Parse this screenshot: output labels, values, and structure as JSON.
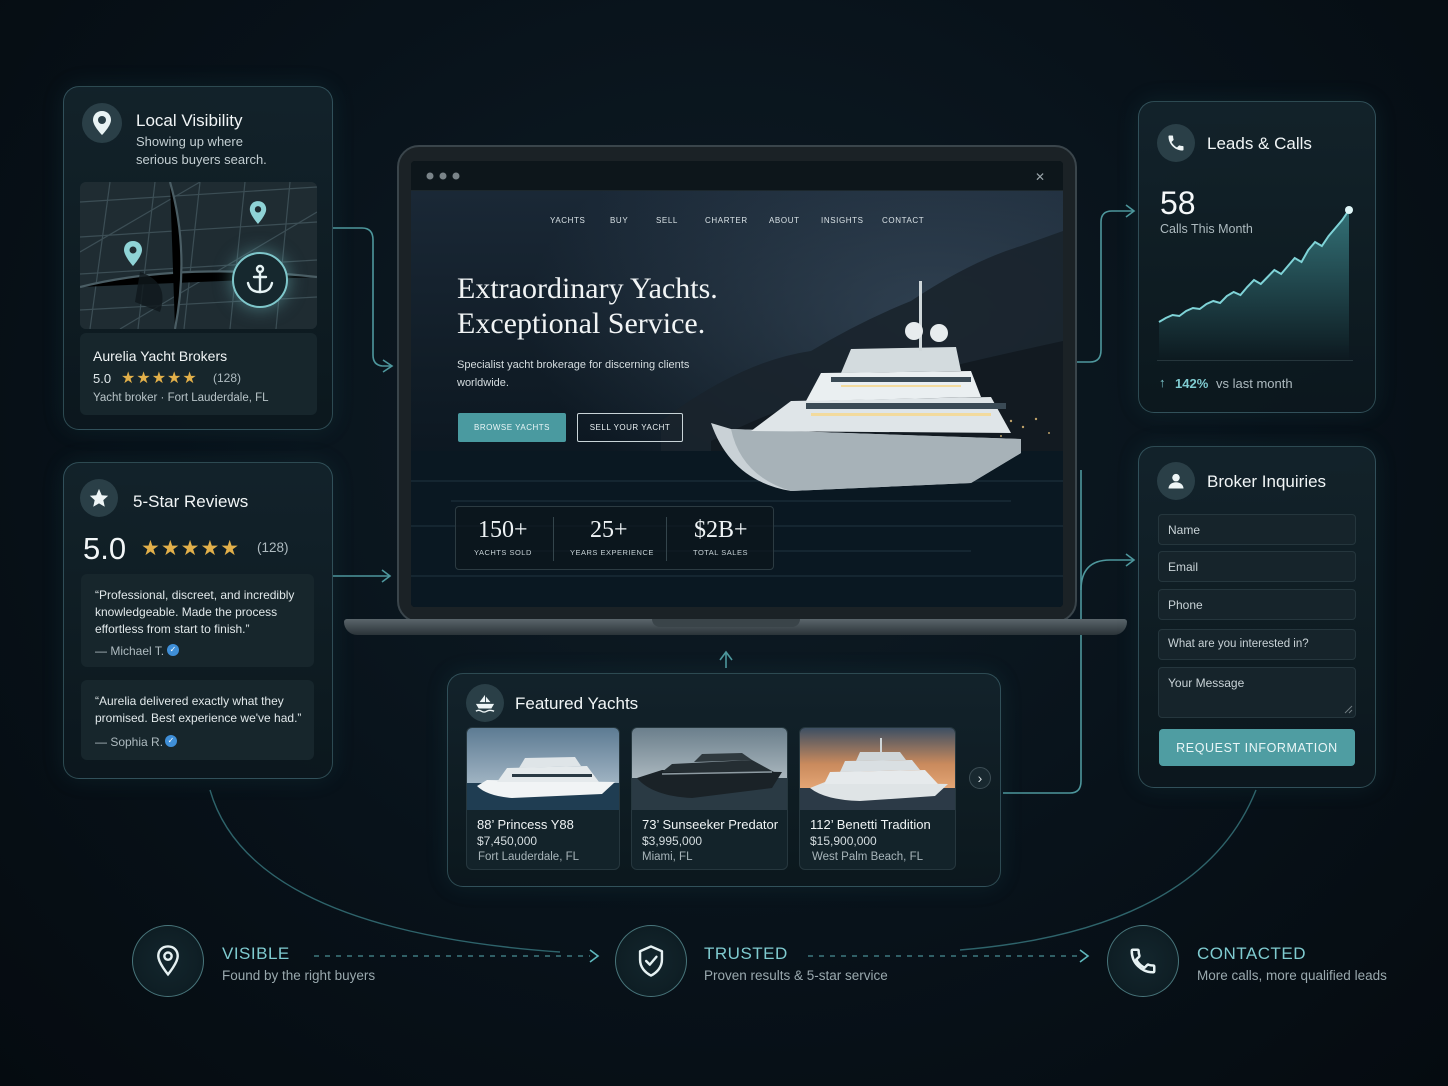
{
  "local_visibility": {
    "title": "Local Visibility",
    "subtitle_line1": "Showing up where",
    "subtitle_line2": "serious buyers search.",
    "business_name": "Aurelia Yacht Brokers",
    "rating": "5.0",
    "review_count": "(128)",
    "category": "Yacht broker · Fort Lauderdale, FL",
    "icon": "map-pin-icon",
    "map_icon": "anchor-icon"
  },
  "reviews": {
    "title": "5-Star Reviews",
    "rating": "5.0",
    "review_count": "(128)",
    "stars": 5,
    "items": [
      {
        "line1": "“Professional, discreet, and incredibly",
        "line2": "knowledgeable. Made the process",
        "line3": "effortless from start to finish.”",
        "author": "— Michael T."
      },
      {
        "line1": "“Aurelia delivered exactly what they",
        "line2": "promised. Best experience we've had.”",
        "author": "— Sophia R."
      }
    ]
  },
  "website": {
    "nav": [
      "YACHTS",
      "BUY",
      "SELL",
      "CHARTER",
      "ABOUT",
      "INSIGHTS",
      "CONTACT"
    ],
    "headline_line1": "Extraordinary Yachts.",
    "headline_line2": "Exceptional Service.",
    "sub_line1": "Specialist yacht brokerage for discerning clients",
    "sub_line2": "worldwide.",
    "primary_cta": "BROWSE YACHTS",
    "secondary_cta": "SELL YOUR YACHT",
    "stats": [
      {
        "value": "150+",
        "label": "YACHTS SOLD"
      },
      {
        "value": "25+",
        "label": "YEARS EXPERIENCE"
      },
      {
        "value": "$2B+",
        "label": "TOTAL SALES"
      }
    ]
  },
  "leads": {
    "title": "Leads & Calls",
    "count": "58",
    "count_label": "Calls This Month",
    "growth": "142%",
    "growth_label": "vs last month",
    "icon": "phone-icon"
  },
  "chart_data": {
    "type": "area",
    "title": "",
    "xlabel": "",
    "ylabel": "",
    "values": [
      10,
      14,
      17,
      16,
      21,
      24,
      23,
      28,
      31,
      29,
      36,
      40,
      37,
      45,
      52,
      48,
      55,
      62,
      58,
      66,
      74,
      70,
      82,
      90,
      86,
      96,
      104,
      112,
      122
    ]
  },
  "inquiries": {
    "title": "Broker Inquiries",
    "name_placeholder": "Name",
    "email_placeholder": "Email",
    "phone_placeholder": "Phone",
    "interest_placeholder": "What are you interested in?",
    "message_placeholder": "Your Message",
    "submit": "REQUEST INFORMATION",
    "icon": "user-icon"
  },
  "featured": {
    "title": "Featured Yachts",
    "icon": "ship-icon",
    "yachts": [
      {
        "name": "88’ Princess Y88",
        "price": "$7,450,000",
        "location": "Fort Lauderdale, FL"
      },
      {
        "name": "73’ Sunseeker Predator",
        "price": "$3,995,000",
        "location": "Miami, FL"
      },
      {
        "name": "112’ Benetti Tradition",
        "price": "$15,900,000",
        "location": "West Palm Beach, FL"
      }
    ]
  },
  "journey": [
    {
      "title": "VISIBLE",
      "subtitle": "Found by the right buyers",
      "icon": "map-pin-icon"
    },
    {
      "title": "TRUSTED",
      "subtitle": "Proven results & 5-star service",
      "icon": "shield-check-icon"
    },
    {
      "title": "CONTACTED",
      "subtitle": "More calls, more qualified leads",
      "icon": "phone-icon"
    }
  ],
  "colors": {
    "accent": "#5fb8bd",
    "star": "#e2b04a",
    "background": "#08121a"
  }
}
